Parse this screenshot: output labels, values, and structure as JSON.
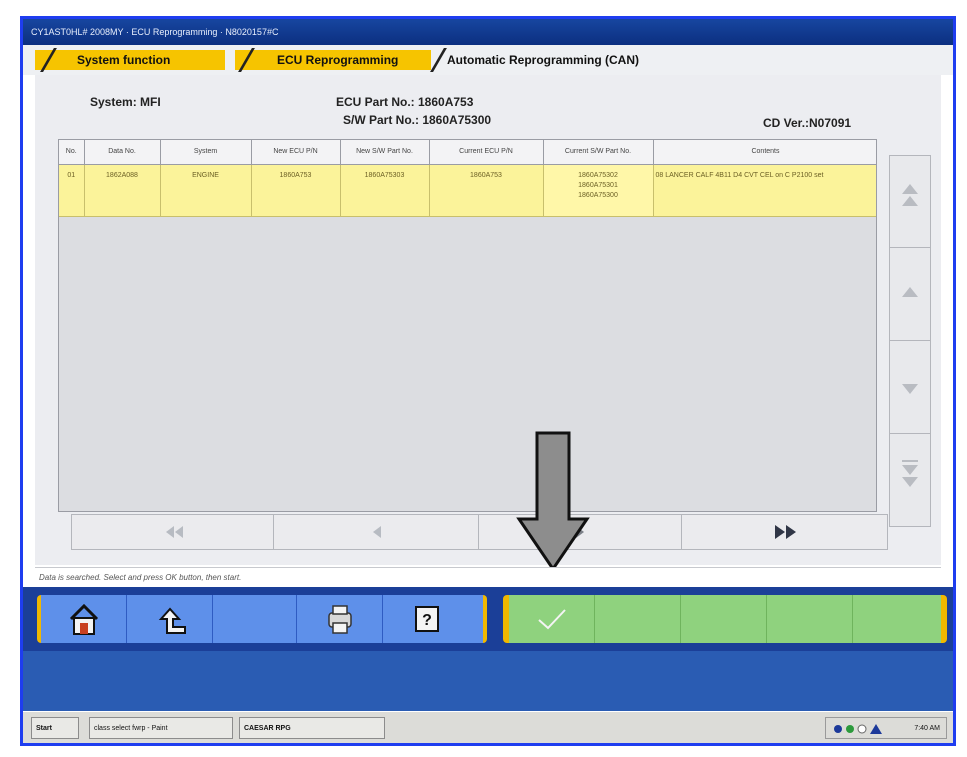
{
  "window": {
    "title": "CY1AST0HL# 2008MY  ·  ECU Reprogramming  ·  N8020157#C"
  },
  "tabs": [
    {
      "label": "System function"
    },
    {
      "label": "ECU Reprogramming"
    },
    {
      "label": "Automatic Reprogramming (CAN)"
    }
  ],
  "info": {
    "system": "System: MFI",
    "ecu_part": "ECU Part No.: 1860A753",
    "sw_part": "S/W Part No.: 1860A75300",
    "cd_ver": "CD Ver.:N07091"
  },
  "table": {
    "headers": [
      "No.",
      "Data No.",
      "System",
      "New ECU P/N",
      "New S/W Part No.",
      "Current ECU P/N",
      "Current S/W Part No.",
      "Contents"
    ],
    "rows": [
      {
        "no": "01",
        "data_no": "1862A088",
        "system": "ENGINE",
        "new_ecu": "1860A753",
        "new_sw": "1860A75303",
        "current_ecu": "1860A753",
        "current_sw": [
          "1860A75302",
          "1860A75301",
          "1860A75300"
        ],
        "contents": "08 LANCER CALF 4B11 D4 CVT   CEL on C P2100 set"
      }
    ]
  },
  "scroll": {
    "icons": [
      "double-up-icon",
      "up-icon",
      "down-icon",
      "double-down-icon"
    ]
  },
  "nav": {
    "icons": [
      "first-page-icon",
      "prev-page-icon",
      "next-page-icon",
      "last-page-icon"
    ]
  },
  "status": {
    "text": "Data is searched. Select and press OK button, then start."
  },
  "toolbar": {
    "icons": [
      "home-icon",
      "back-icon",
      "printer-icon",
      "help-icon"
    ],
    "ok_icon": "checkmark-icon",
    "colors": {
      "blue": "#5e90ea",
      "green": "#8fd27e",
      "frame": "#f0b800"
    }
  },
  "taskbar": {
    "start": "Start",
    "item1": "class select fwrp - Paint",
    "item2": "CAESAR RPG",
    "clock": "7:40 AM"
  }
}
